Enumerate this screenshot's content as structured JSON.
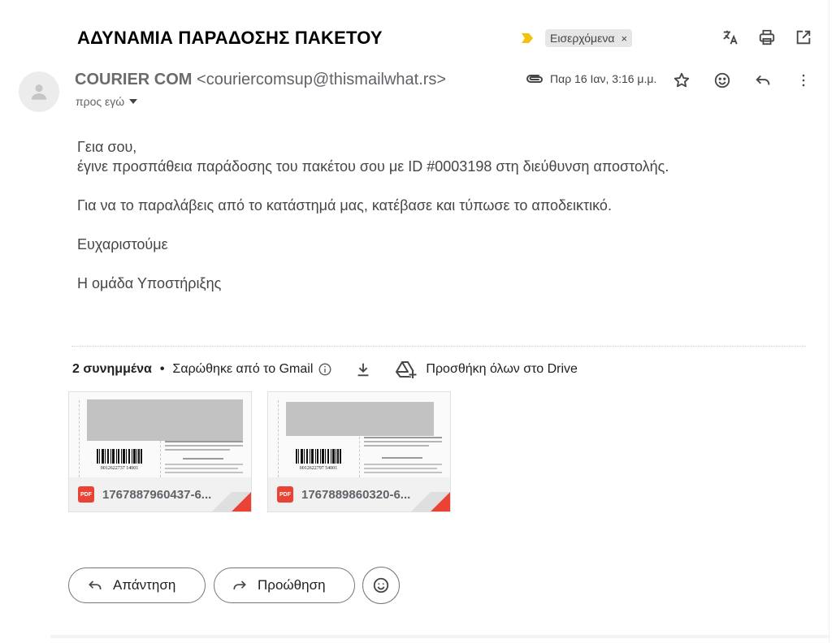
{
  "email": {
    "subject": "ΑΔΥΝΑΜΙΑ ΠΑΡΑΔΟΣΗΣ ΠΑΚΕΤΟΥ",
    "label": "Εισερχόμενα",
    "label_remove": "×",
    "sender_name": "COURIER COM",
    "sender_email": "<couriercomsup@thismailwhat.rs>",
    "to_text": "προς εγώ",
    "date": "Παρ 16 Ιαν, 3:16 μ.μ.",
    "body": {
      "line1": "Γεια σου,",
      "line2": "έγινε προσπάθεια παράδοσης του πακέτου σου με ID #0003198 στη διεύθυνση αποστολής.",
      "line3": "Για να το παραλάβεις από το κατάστημά μας, κατέβασε και τύπωσε το αποδεικτικό.",
      "line4": "Ευχαριστούμε",
      "line5": "Η ομάδα Υποστήριξης"
    }
  },
  "attachments": {
    "count_label": "2 συνημμένα",
    "dot": "•",
    "scanned": "Σαρώθηκε από το Gmail",
    "drive_label": "Προσθήκη όλων στο Drive",
    "files": [
      {
        "name": "1767887960437-6...",
        "barcode": "0012622737 14001",
        "type_badge": "PDF"
      },
      {
        "name": "1767889860320-6...",
        "barcode": "0012622797 54001",
        "type_badge": "PDF"
      }
    ]
  },
  "actions": {
    "reply": "Απάντηση",
    "forward": "Προώθηση"
  },
  "colors": {
    "label_arrow": "#f4c20d",
    "pdf_red": "#ea4335",
    "text_gray": "#444746"
  },
  "icons": {
    "translate": "translate-icon",
    "print": "print-icon",
    "open_new": "open-in-new-icon",
    "attachment": "paperclip-icon",
    "star": "star-icon",
    "emoji": "emoji-icon",
    "reply": "reply-icon",
    "more": "more-vert-icon"
  }
}
